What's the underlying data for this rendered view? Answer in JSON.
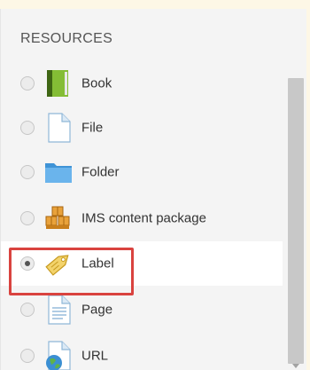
{
  "resources": {
    "section_title": "RESOURCES",
    "items": [
      {
        "label": "Book",
        "icon": "book-icon",
        "selected": false
      },
      {
        "label": "File",
        "icon": "file-icon",
        "selected": false
      },
      {
        "label": "Folder",
        "icon": "folder-icon",
        "selected": false
      },
      {
        "label": "IMS content package",
        "icon": "ims-package-icon",
        "selected": false
      },
      {
        "label": "Label",
        "icon": "label-tag-icon",
        "selected": true
      },
      {
        "label": "Page",
        "icon": "page-icon",
        "selected": false
      },
      {
        "label": "URL",
        "icon": "url-globe-icon",
        "selected": false
      }
    ]
  },
  "colors": {
    "highlight_border": "#d9433f",
    "panel_bg": "#f4f4f4",
    "selected_bg": "#ffffff",
    "outer_bg": "#fdf7e6"
  }
}
